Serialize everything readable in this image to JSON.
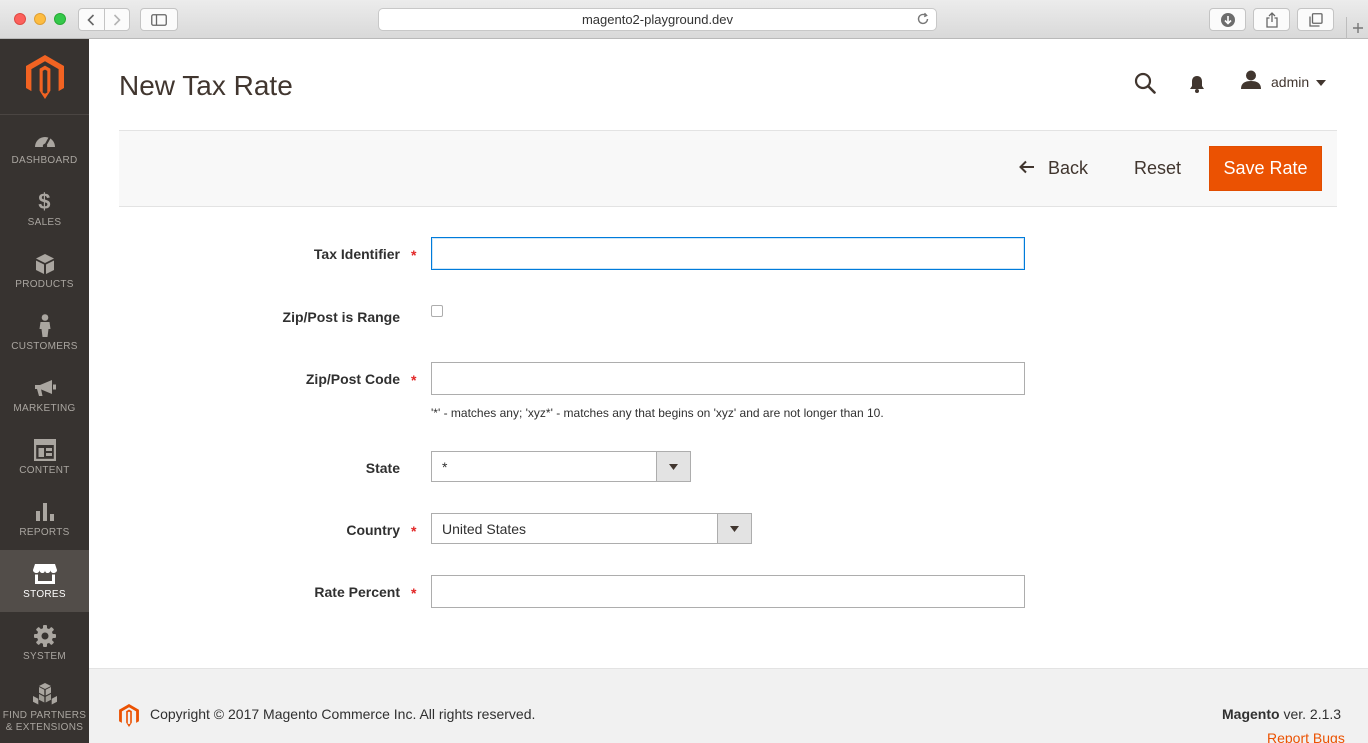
{
  "browser": {
    "url": "magento2-playground.dev",
    "icons": [
      "back-icon",
      "forward-icon",
      "sidebar-toggle-icon",
      "reload-icon",
      "download-icon",
      "share-icon",
      "tabs-icon",
      "new-tab-icon"
    ]
  },
  "sidebar": {
    "items": [
      {
        "label": "DASHBOARD",
        "icon": "dashboard-icon"
      },
      {
        "label": "SALES",
        "icon": "dollar-icon"
      },
      {
        "label": "PRODUCTS",
        "icon": "box-icon"
      },
      {
        "label": "CUSTOMERS",
        "icon": "person-icon"
      },
      {
        "label": "MARKETING",
        "icon": "megaphone-icon"
      },
      {
        "label": "CONTENT",
        "icon": "layout-icon"
      },
      {
        "label": "REPORTS",
        "icon": "bar-chart-icon"
      },
      {
        "label": "STORES",
        "icon": "storefront-icon",
        "active": true
      },
      {
        "label": "SYSTEM",
        "icon": "gear-icon"
      },
      {
        "label_line1": "FIND PARTNERS",
        "label_line2": "& EXTENSIONS",
        "icon": "cubes-icon"
      }
    ]
  },
  "header": {
    "title": "New Tax Rate",
    "user": "admin"
  },
  "actions": {
    "back": "Back",
    "reset": "Reset",
    "save": "Save Rate"
  },
  "form": {
    "tax_identifier": {
      "label": "Tax Identifier",
      "value": ""
    },
    "zip_is_range": {
      "label": "Zip/Post is Range",
      "checked": false
    },
    "zip_code": {
      "label": "Zip/Post Code",
      "value": "",
      "note": "'*' - matches any; 'xyz*' - matches any that begins on 'xyz' and are not longer than 10."
    },
    "state": {
      "label": "State",
      "value": "*"
    },
    "country": {
      "label": "Country",
      "value": "United States"
    },
    "rate_percent": {
      "label": "Rate Percent",
      "value": ""
    },
    "required_mark": "*"
  },
  "footer": {
    "copyright": "Copyright © 2017 Magento Commerce Inc. All rights reserved.",
    "brand": "Magento",
    "version": " ver. 2.1.3",
    "report_bugs": "Report Bugs"
  },
  "colors": {
    "accent": "#eb5202",
    "sidebar": "#373330",
    "required": "#e22626"
  }
}
